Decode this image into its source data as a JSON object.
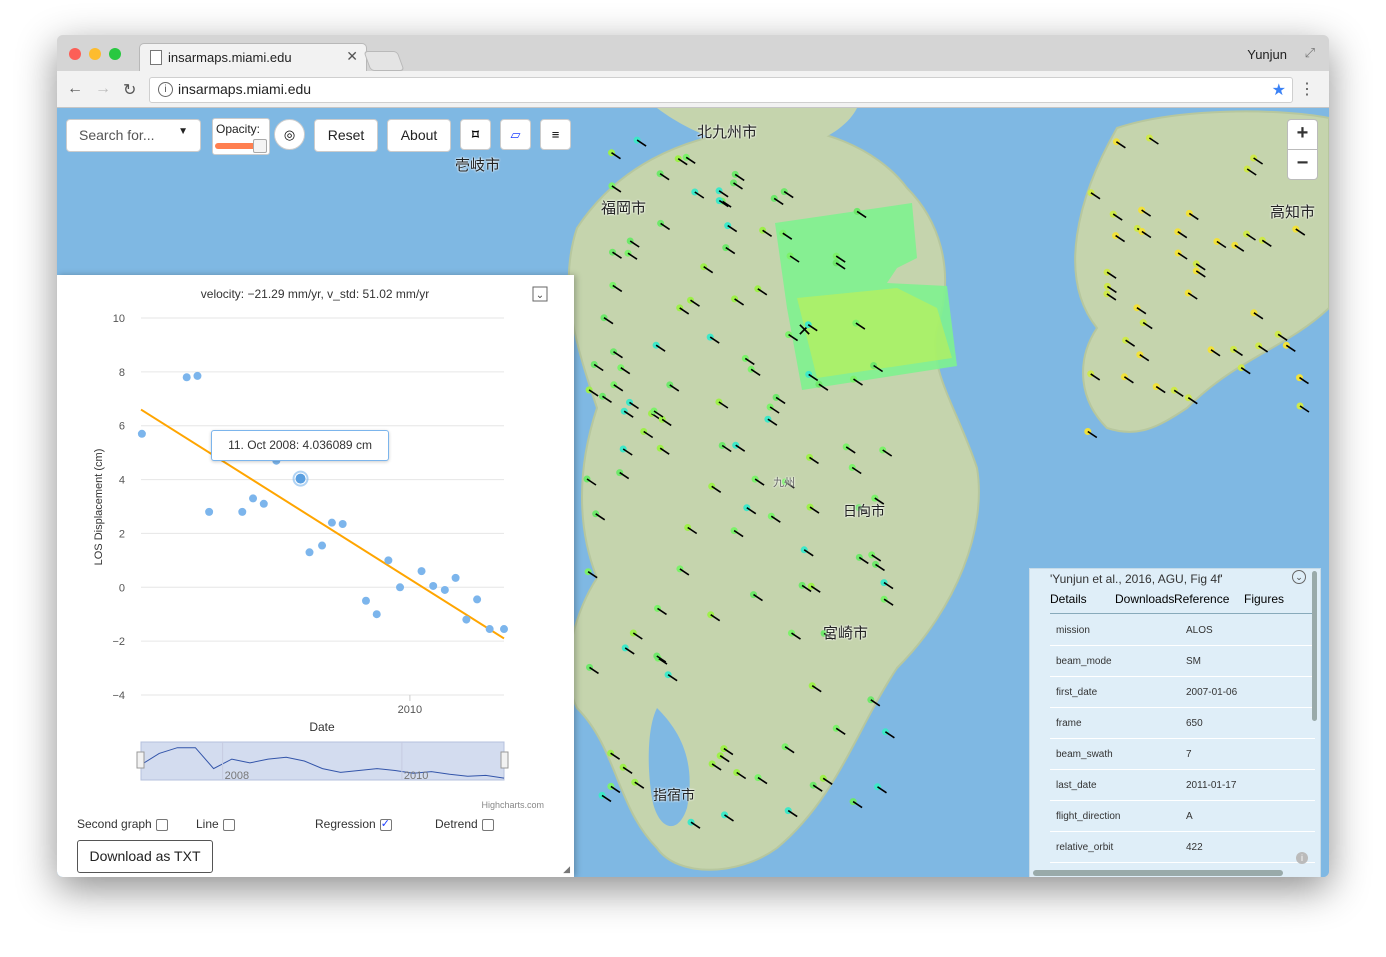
{
  "browser": {
    "tab_title": "insarmaps.miami.edu",
    "profile_name": "Yunjun",
    "url": "insarmaps.miami.edu"
  },
  "controls": {
    "search_placeholder": "Search for...",
    "opacity_label": "Opacity:",
    "reset_label": "Reset",
    "about_label": "About",
    "zoom_in": "+",
    "zoom_out": "−"
  },
  "map": {
    "cities": [
      "北九州市",
      "壱岐市",
      "福岡市",
      "高知市",
      "日向市",
      "宮崎市",
      "指宿市",
      "九州"
    ]
  },
  "chart_panel": {
    "second_graph_label": "Second graph",
    "line_label": "Line",
    "regression_label": "Regression",
    "detrend_label": "Detrend",
    "download_label": "Download as TXT",
    "credits": "Highcharts.com",
    "tooltip": "11. Oct 2008: 4.036089 cm"
  },
  "chart_data": {
    "type": "scatter",
    "title": "velocity: −21.29 mm/yr, v_std: 51.02 mm/yr",
    "xlabel": "Date",
    "ylabel": "LOS Displacement (cm)",
    "ylim": [
      -4,
      10
    ],
    "xlim": [
      2007.0,
      2011.05
    ],
    "yticks": [
      10,
      8,
      6,
      4,
      2,
      0,
      -2,
      -4
    ],
    "yticklabels": [
      "10",
      "8",
      "6",
      "4",
      "2",
      "0",
      "−2",
      "−4"
    ],
    "xticks": [
      2010
    ],
    "navigator_ticks": [
      2008,
      2010
    ],
    "series": [
      {
        "x": [
          2007.01,
          2007.51,
          2007.63,
          2007.76,
          2008.13,
          2008.25,
          2008.37,
          2008.51,
          2008.63,
          2008.78,
          2008.88,
          2009.02,
          2009.13,
          2009.25,
          2009.51,
          2009.63,
          2009.76,
          2009.89,
          2010.13,
          2010.26,
          2010.39,
          2010.51,
          2010.63,
          2010.75,
          2010.89,
          2011.05
        ],
        "y": [
          5.7,
          7.8,
          7.85,
          2.8,
          2.8,
          3.3,
          3.1,
          4.7,
          5.2,
          4.04,
          1.3,
          1.55,
          2.4,
          2.35,
          -0.5,
          -1.0,
          1.0,
          0.0,
          0.6,
          0.05,
          -0.1,
          0.35,
          -1.2,
          -0.45,
          -1.55,
          -1.55
        ]
      },
      {
        "name": "Regression",
        "type": "line",
        "x": [
          2007.0,
          2011.05
        ],
        "y": [
          6.6,
          -1.9
        ],
        "color": "#ffa500"
      }
    ],
    "navigator_values": [
      0.4,
      0.7,
      0.85,
      0.85,
      0.3,
      0.55,
      0.45,
      0.55,
      0.6,
      0.5,
      0.3,
      0.2,
      0.25,
      0.3,
      0.25,
      0.18,
      0.22,
      0.15,
      0.1,
      0.12,
      0.05
    ],
    "highlight": {
      "x": 2008.78,
      "y": 4.036089
    },
    "grid": true,
    "legend": "none"
  },
  "info_panel": {
    "title": "'Yunjun et al., 2016, AGU, Fig 4f'",
    "tabs": [
      "Details",
      "Downloads",
      "Reference",
      "Figures"
    ],
    "rows": [
      {
        "key": "mission",
        "value": "ALOS"
      },
      {
        "key": "beam_mode",
        "value": "SM"
      },
      {
        "key": "first_date",
        "value": "2007-01-06"
      },
      {
        "key": "frame",
        "value": "650"
      },
      {
        "key": "beam_swath",
        "value": "7"
      },
      {
        "key": "last_date",
        "value": "2011-01-17"
      },
      {
        "key": "flight_direction",
        "value": "A"
      },
      {
        "key": "relative_orbit",
        "value": "422"
      }
    ]
  },
  "colors": {
    "sea": "#7fb8e3",
    "land": "#c8d6b0",
    "accent_orange": "#ff7f50",
    "regression": "#ffa500",
    "point": "#7cb5ec"
  }
}
